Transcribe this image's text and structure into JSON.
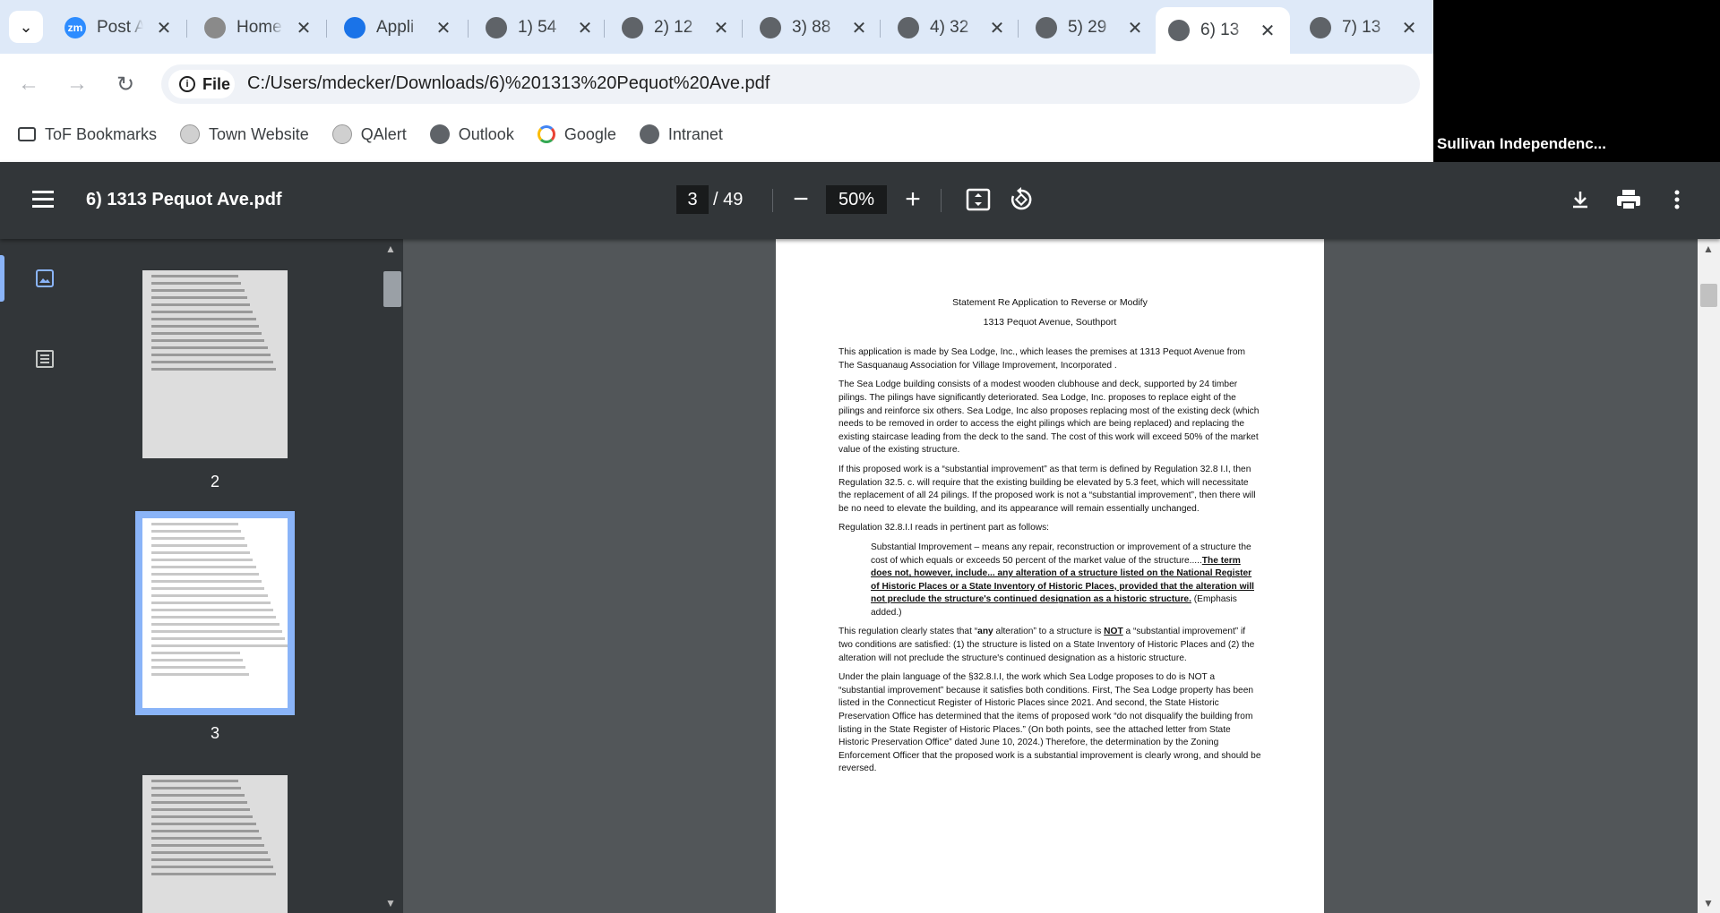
{
  "tabs": [
    {
      "title": "Post A",
      "favicon": "zoom-icon",
      "favicon_text": "zm",
      "color": "#2d8cff",
      "active": false
    },
    {
      "title": "Home",
      "favicon": "town-seal-icon",
      "favicon_text": "",
      "color": "#8a8a8a",
      "active": false
    },
    {
      "title": "Appli",
      "favicon": "document-form-icon",
      "favicon_text": "",
      "color": "#1a73e8",
      "active": false
    },
    {
      "title": "1) 54",
      "favicon": "globe-icon",
      "favicon_text": "",
      "color": "#5f6368",
      "active": false
    },
    {
      "title": "2) 12",
      "favicon": "globe-icon",
      "favicon_text": "",
      "color": "#5f6368",
      "active": false
    },
    {
      "title": "3) 88",
      "favicon": "globe-icon",
      "favicon_text": "",
      "color": "#5f6368",
      "active": false
    },
    {
      "title": "4) 32",
      "favicon": "globe-icon",
      "favicon_text": "",
      "color": "#5f6368",
      "active": false
    },
    {
      "title": "5) 29",
      "favicon": "globe-icon",
      "favicon_text": "",
      "color": "#5f6368",
      "active": false
    },
    {
      "title": "6) 13",
      "favicon": "globe-icon",
      "favicon_text": "",
      "color": "#5f6368",
      "active": true
    },
    {
      "title": "7) 13",
      "favicon": "globe-icon",
      "favicon_text": "",
      "color": "#5f6368",
      "active": false
    }
  ],
  "toolbar": {
    "site_info_label": "File",
    "url": "C:/Users/mdecker/Downloads/6)%201313%20Pequot%20Ave.pdf"
  },
  "bookmarks": [
    {
      "label": "ToF Bookmarks",
      "icon": "folder-gear-icon"
    },
    {
      "label": "Town Website",
      "icon": "town-seal-icon"
    },
    {
      "label": "QAlert",
      "icon": "town-seal-icon"
    },
    {
      "label": "Outlook",
      "icon": "globe-icon"
    },
    {
      "label": "Google",
      "icon": "google-icon"
    },
    {
      "label": "Intranet",
      "icon": "globe-icon"
    }
  ],
  "video": {
    "participant_name": "Sullivan Independenc..."
  },
  "pdf": {
    "title": "6) 1313 Pequot Ave.pdf",
    "current_page": "3",
    "total_pages": "/ 49",
    "zoom": "50%"
  },
  "thumbnails": [
    {
      "label": "2",
      "selected": false
    },
    {
      "label": "3",
      "selected": true
    },
    {
      "label": "",
      "selected": false
    }
  ],
  "document": {
    "heading1": "Statement Re Application to Reverse or Modify",
    "heading2": "1313 Pequot Avenue, Southport",
    "p1": "This application is made by Sea Lodge, Inc., which leases the premises at 1313 Pequot Avenue from The Sasquanaug Association for Village Improvement, Incorporated .",
    "p2": "The Sea Lodge building consists of a modest wooden clubhouse and deck, supported by 24 timber pilings. The pilings have significantly deteriorated. Sea Lodge, Inc. proposes to replace eight of the pilings and reinforce six others. Sea Lodge, Inc also proposes replacing most of the existing deck (which needs to be removed in order to access the eight pilings which are being replaced) and replacing the existing staircase leading from the deck to the sand. The cost of this work will exceed 50% of the market value of the existing structure.",
    "p3": "If this proposed work is a “substantial improvement” as that term is defined by Regulation 32.8 I.I, then Regulation 32.5. c. will require that the existing building be elevated by 5.3 feet, which will necessitate the replacement of all 24 pilings. If the proposed work is not a “substantial improvement”, then there will be no need to elevate the building, and its appearance will remain essentially unchanged.",
    "p4": "Regulation 32.8.I.I reads in pertinent part as follows:",
    "quote_plain": "Substantial Improvement – means any repair, reconstruction or improvement of a structure the cost of which equals or exceeds 50 percent of the market value of the structure.....",
    "quote_bold": "The term does not, however, include... any alteration of a structure listed on the National Register of Historic Places or a State Inventory of Historic Places, provided that the alteration will not preclude the structure's continued designation as a historic structure.",
    "quote_tail": " (Emphasis added.)",
    "p5a": "This regulation clearly states that “",
    "p5b": "any",
    "p5c": " alteration” to a structure is ",
    "p5d": "NOT",
    "p5e": " a “substantial improvement” if two conditions are satisfied: (1) the structure is listed on a State Inventory of Historic Places and (2) the alteration will not preclude the structure's continued designation as a historic structure.",
    "p6": "Under the plain language of the §32.8.I.I, the work which Sea Lodge proposes to do is NOT a “substantial improvement” because it satisfies both conditions. First, The Sea Lodge property has been listed in the Connecticut Register of Historic Places since 2021. And second, the State Historic Preservation Office has determined that the items of proposed work “do not disqualify the building from listing in the State Register of Historic Places.” (On both points, see the attached letter from State Historic Preservation Office” dated June 10, 2024.) Therefore, the determination by the Zoning Enforcement Officer that the proposed work is a substantial improvement is clearly wrong, and should be reversed."
  }
}
